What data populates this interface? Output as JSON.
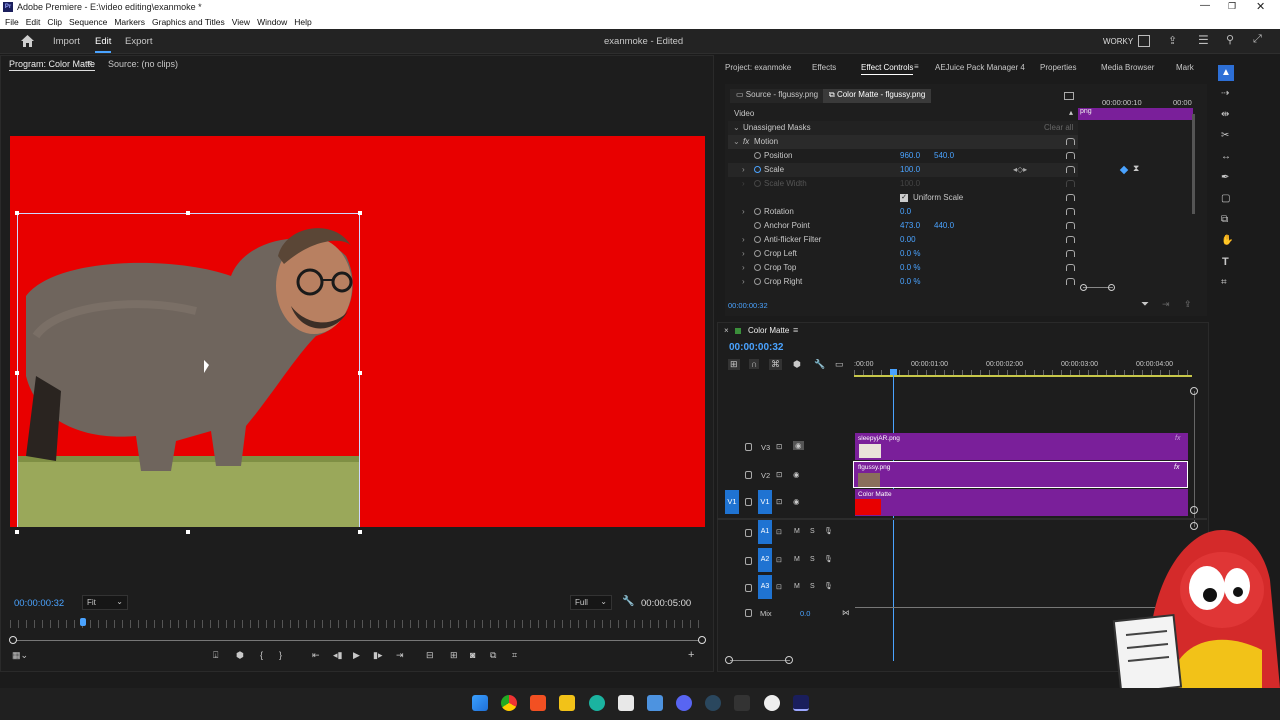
{
  "window": {
    "title": "Adobe Premiere - E:\\video editing\\exanmoke *"
  },
  "menu": [
    "File",
    "Edit",
    "Clip",
    "Sequence",
    "Markers",
    "Graphics and Titles",
    "View",
    "Window",
    "Help"
  ],
  "header": {
    "home": "",
    "import": "Import",
    "edit": "Edit",
    "export": "Export",
    "project": "exanmoke - Edited",
    "workspace": "WORKY"
  },
  "program": {
    "tab_program": "Program: Color Matte",
    "tab_source": "Source: (no clips)",
    "timecode": "00:00:00:32",
    "fit": "Fit",
    "quality": "Full",
    "duration": "00:00:05:00"
  },
  "right_tabs": [
    "Project: exanmoke",
    "Effects",
    "Effect Controls",
    "AEJuice Pack Manager 4",
    "Properties",
    "Media Browser",
    "Mark"
  ],
  "effect_controls": {
    "source_tab": "Source - flgussy.png",
    "matte_tab": "Color Matte - flgussy.png",
    "video": "Video",
    "masks": "Unassigned Masks",
    "clear_all": "Clear all",
    "motion": "Motion",
    "rows": [
      {
        "label": "Position",
        "v1": "960.0",
        "v2": "540.0"
      },
      {
        "label": "Scale",
        "v1": "100.0",
        "v2": ""
      },
      {
        "label": "Scale Width",
        "v1": "100.0",
        "v2": ""
      },
      {
        "label": "Uniform Scale",
        "v1": "",
        "v2": ""
      },
      {
        "label": "Rotation",
        "v1": "0.0",
        "v2": ""
      },
      {
        "label": "Anchor Point",
        "v1": "473.0",
        "v2": "440.0"
      },
      {
        "label": "Anti-flicker Filter",
        "v1": "0.00",
        "v2": ""
      },
      {
        "label": "Crop Left",
        "v1": "0.0 %",
        "v2": ""
      },
      {
        "label": "Crop Top",
        "v1": "0.0 %",
        "v2": ""
      },
      {
        "label": "Crop Right",
        "v1": "0.0 %",
        "v2": ""
      }
    ],
    "mini_tc1": "00:00:00:10",
    "mini_tc2": "00:00",
    "mini_clip": "png",
    "timecode": "00:00:00:32"
  },
  "timeline": {
    "title": "Color Matte",
    "timecode": "00:00:00:32",
    "ruler": [
      ":00:00",
      "00:00:01:00",
      "00:00:02:00",
      "00:00:03:00",
      "00:00:04:00"
    ],
    "tracks": [
      {
        "name": "V3",
        "clip": "sleepyjAR.png"
      },
      {
        "name": "V2",
        "clip": "flgussy.png"
      },
      {
        "name": "V1",
        "clip": "Color Matte"
      }
    ],
    "audio": [
      "A1",
      "A2",
      "A3"
    ],
    "src_v1": "V1",
    "mix": "Mix",
    "mix_val": "0.0",
    "m": "M",
    "s": "S",
    "fx": "fx"
  },
  "colors": {
    "accent": "#4aa3ff",
    "clip": "#7a1f9a",
    "matte": "#e80000",
    "panel": "#1f1f1f"
  }
}
